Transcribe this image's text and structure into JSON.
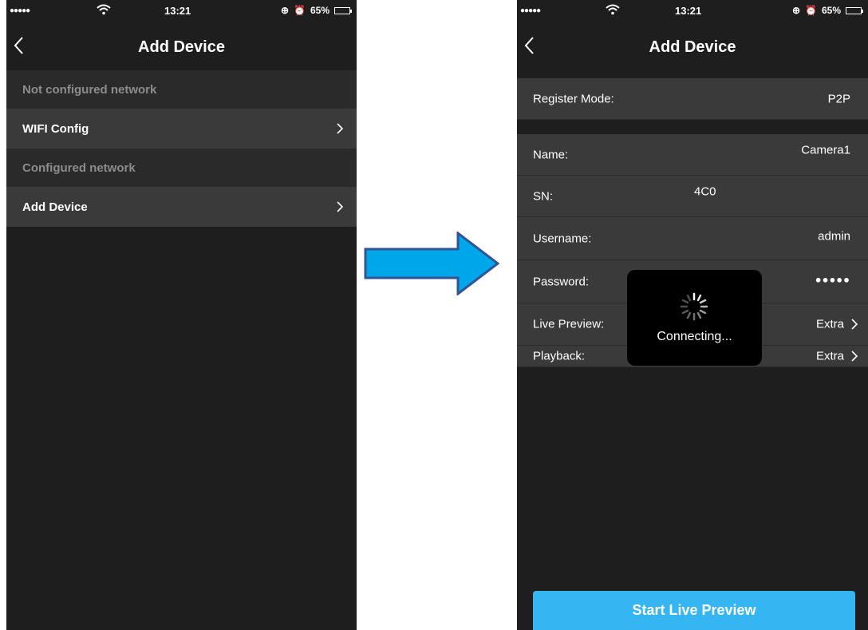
{
  "left": {
    "status": {
      "time": "13:21",
      "battery": "65%",
      "battery_level": 0.65
    },
    "title": "Add Device",
    "sections": [
      {
        "header": "Not configured network",
        "item": "WIFI Config"
      },
      {
        "header": "Configured network",
        "item": "Add Device"
      }
    ]
  },
  "right": {
    "status": {
      "time": "13:21",
      "battery": "65%",
      "battery_level": 0.65
    },
    "title": "Add Device",
    "register_mode": {
      "label": "Register Mode:",
      "value": "P2P"
    },
    "fields": [
      {
        "label": "Name:",
        "value": "Camera1"
      },
      {
        "label": "SN:",
        "value": "4C0"
      },
      {
        "label": "Username:",
        "value": "admin"
      },
      {
        "label": "Password:",
        "value": "●●●●●"
      },
      {
        "label": "Live Preview:",
        "value": "Extra"
      },
      {
        "label": "Playback:",
        "value": "Extra"
      }
    ],
    "toast": "Connecting...",
    "button": "Start Live Preview"
  },
  "colors": {
    "background": "#1e1e1e",
    "cell": "#3a3a3a",
    "section": "#2a2a2a",
    "accent": "#35b6f2",
    "arrow_fill": "#00a6ea",
    "arrow_stroke": "#2f5597"
  },
  "icons": [
    "back-chevron-icon",
    "chevron-right-icon",
    "wifi-icon",
    "alarm-icon",
    "battery-icon",
    "spinner-icon",
    "right-arrow-icon"
  ]
}
